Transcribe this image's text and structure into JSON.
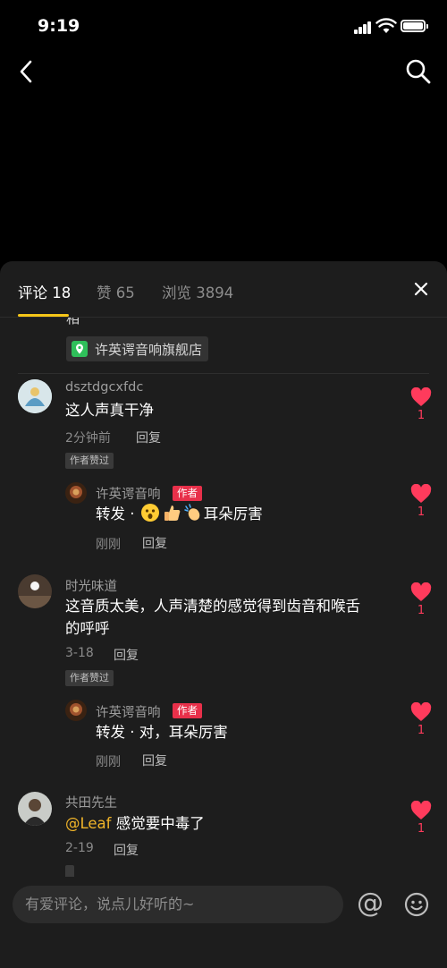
{
  "status_bar": {
    "time": "9:19"
  },
  "tabs": [
    {
      "label": "评论 18"
    },
    {
      "label": "赞 65"
    },
    {
      "label": "浏览 3894"
    }
  ],
  "partial_text": "相",
  "location_tag": {
    "label": "许英谔音响旗舰店"
  },
  "comments": [
    {
      "username": "dsztdgcxfdc",
      "text": "这人声真干净",
      "time": "2分钟前",
      "reply_label": "回复",
      "badge": "作者赞过",
      "likes": "1",
      "reply": {
        "username": "许英谔音响",
        "author_badge": "作者",
        "text_prefix": "转发 · ",
        "text_suffix": "耳朵厉害",
        "time": "刚刚",
        "reply_label": "回复",
        "likes": "1"
      }
    },
    {
      "username": "时光味道",
      "text_line1": "这音质太美，人声清楚的感觉得到齿音和喉舌",
      "text_line2": "的呼呼",
      "time": "3-18",
      "reply_label": "回复",
      "badge": "作者赞过",
      "likes": "1",
      "reply": {
        "username": "许英谔音响",
        "author_badge": "作者",
        "text": "转发 · 对，耳朵厉害",
        "time": "刚刚",
        "reply_label": "回复",
        "likes": "1"
      }
    },
    {
      "username": "共田先生",
      "mention": "@Leaf",
      "text": " 感觉要中毒了",
      "time": "2-19",
      "reply_label": "回复",
      "likes": "1"
    }
  ],
  "input": {
    "placeholder": "有爱评论，说点儿好听的~"
  },
  "at_symbol": "@",
  "colors": {
    "accent": "#f5c518",
    "like": "#ff3b5c",
    "author_badge": "#e8304a",
    "mention": "#f0b429"
  }
}
